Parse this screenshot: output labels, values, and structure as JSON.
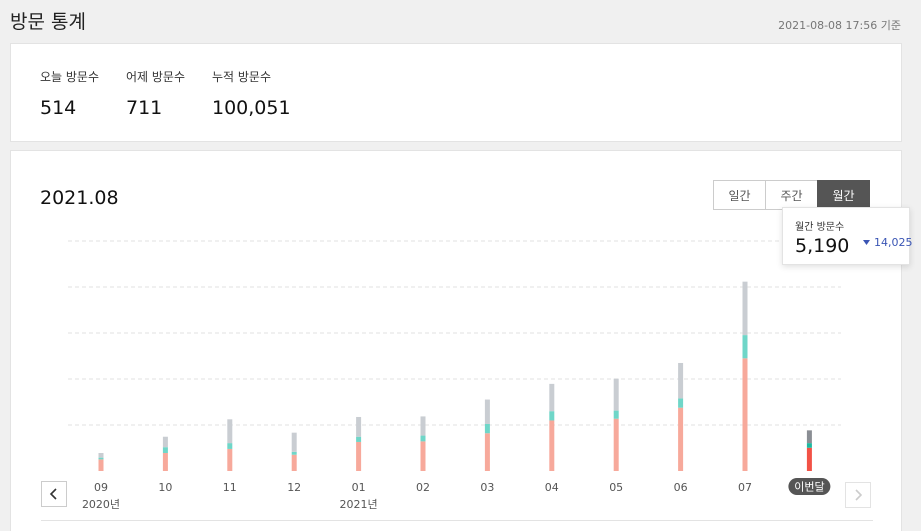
{
  "header": {
    "title": "방문 통계",
    "timestamp": "2021-08-08 17:56 기준"
  },
  "summary": {
    "today": {
      "label": "오늘 방문수",
      "value": "514"
    },
    "yesterday": {
      "label": "어제 방문수",
      "value": "711"
    },
    "total": {
      "label": "누적 방문수",
      "value": "100,051"
    }
  },
  "chart_panel": {
    "period_title": "2021.08",
    "view_tabs": [
      {
        "label": "일간",
        "active": false
      },
      {
        "label": "주간",
        "active": false
      },
      {
        "label": "월간",
        "active": true
      }
    ],
    "prev_icon": "chevron-left-icon",
    "next_icon": "chevron-right-icon"
  },
  "tooltip": {
    "label": "월간 방문수",
    "value": "5,190",
    "compare_icon": "triangle-down-icon",
    "compare_value": "14,025"
  },
  "colors": {
    "bar_bottom": "#f7a99b",
    "bar_middle": "#6fd6c8",
    "bar_top": "#c9cdd2",
    "current_bottom": "#f25246",
    "current_middle": "#1cb8a0",
    "current_top": "#8a8e94",
    "active_tab": "#555555",
    "compare_text": "#3a55b4"
  },
  "chart_data": {
    "type": "bar",
    "stacked": true,
    "categories": [
      "09",
      "10",
      "11",
      "12",
      "01",
      "02",
      "03",
      "04",
      "05",
      "06",
      "07",
      "이번달"
    ],
    "year_labels": [
      {
        "label": "2020년",
        "category_index": 0
      },
      {
        "label": "2021년",
        "category_index": 4
      }
    ],
    "highlight_index": 11,
    "series": [
      {
        "values": [
          2000,
          3100,
          3800,
          2800,
          5000,
          5100,
          6500,
          8700,
          9000,
          10900,
          19400,
          4000
        ]
      },
      {
        "values": [
          300,
          1000,
          1000,
          500,
          900,
          1000,
          1600,
          1600,
          1400,
          1600,
          4000,
          800
        ]
      },
      {
        "values": [
          800,
          1800,
          4100,
          3300,
          3400,
          3300,
          4200,
          4700,
          5500,
          6100,
          9200,
          2200
        ]
      }
    ],
    "ylim": [
      0,
      39600
    ],
    "grid": true,
    "grid_lines": 5
  }
}
